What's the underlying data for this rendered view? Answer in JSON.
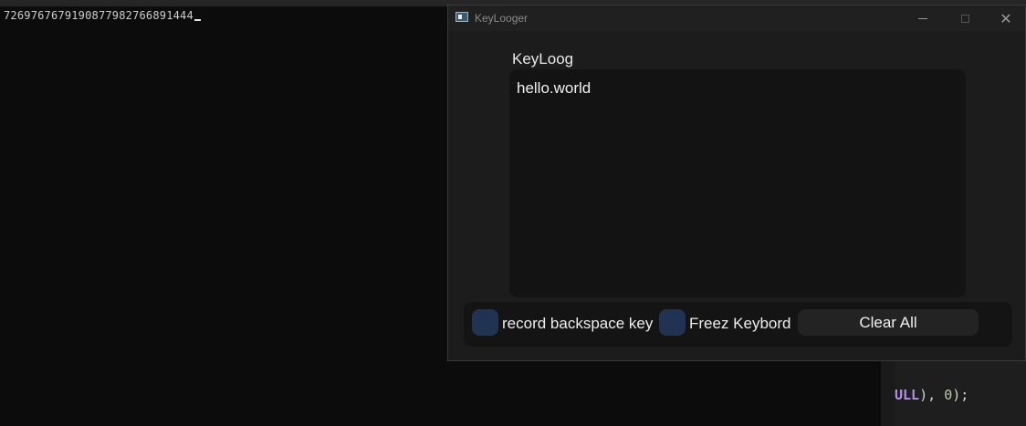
{
  "console": {
    "output_text": "7269767679190877982766891444"
  },
  "editor": {
    "code_purple": "ULL",
    "code_punct1": "), ",
    "code_num": "0",
    "code_punct2": ");"
  },
  "keylogger": {
    "window_title": "KeyLooger",
    "minimize_symbol": "",
    "maximize_symbol": "",
    "close_symbol": "✕",
    "log_label": "KeyLoog",
    "log_text": "hello.world",
    "checkbox_backspace_label": "record backspace key",
    "checkbox_freeze_label": "Freez Keybord",
    "clear_button_label": "Clear All",
    "accent_color": "#203352"
  },
  "icons": {
    "app_icon": "window-app-icon",
    "minimize": "minimize-icon",
    "maximize": "maximize-icon",
    "close": "close-icon"
  }
}
